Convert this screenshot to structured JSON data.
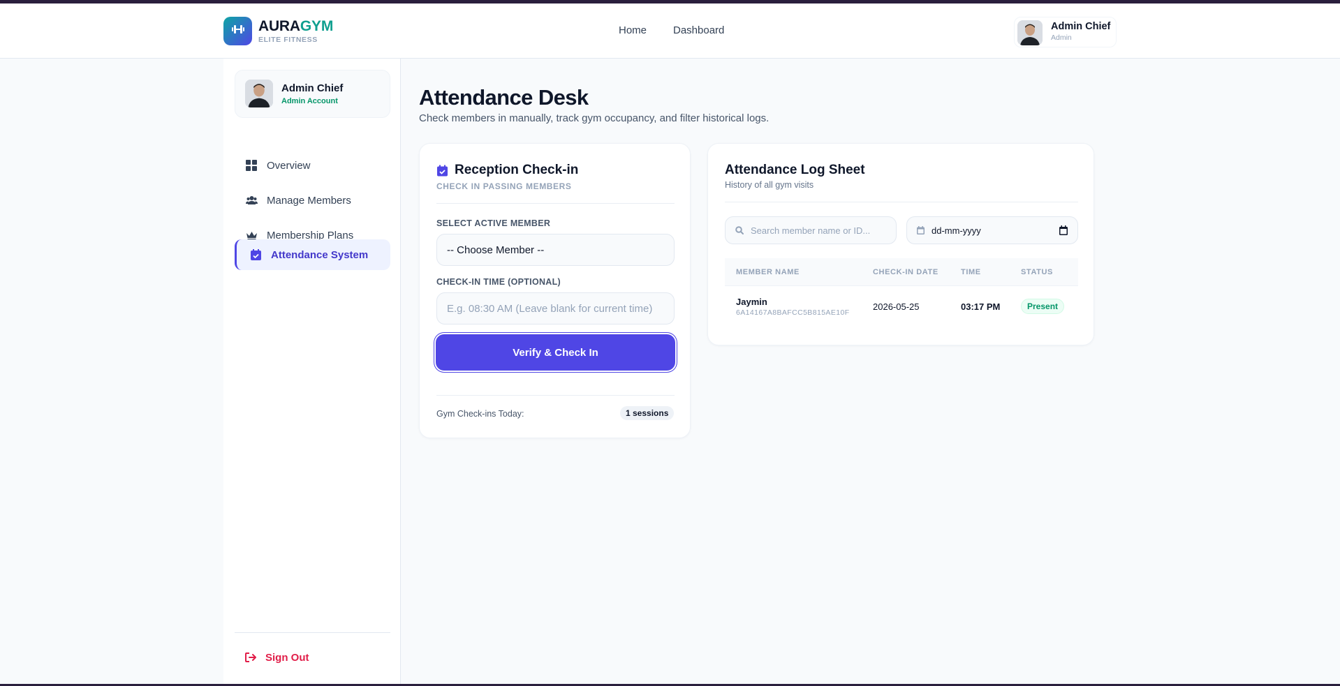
{
  "brand": {
    "name_part1": "AURA",
    "name_part2": "GYM",
    "subtitle": "ELITE FITNESS"
  },
  "nav": {
    "home": "Home",
    "dashboard": "Dashboard"
  },
  "user": {
    "name": "Admin Chief",
    "role": "Admin"
  },
  "sidebar": {
    "profile": {
      "name": "Admin Chief",
      "role": "Admin Account"
    },
    "items": [
      {
        "label": "Overview",
        "icon": "grid-icon"
      },
      {
        "label": "Manage Members",
        "icon": "users-icon"
      },
      {
        "label": "Membership Plans",
        "icon": "crown-icon"
      },
      {
        "label": "Attendance System",
        "icon": "calendar-check-icon",
        "active": true
      }
    ],
    "signout": "Sign Out"
  },
  "page": {
    "title": "Attendance Desk",
    "subtitle": "Check members in manually, track gym occupancy, and filter historical logs."
  },
  "checkin": {
    "title": "Reception Check-in",
    "subtitle": "CHECK IN PASSING MEMBERS",
    "member_label": "SELECT ACTIVE MEMBER",
    "member_value": "-- Choose Member --",
    "time_label": "CHECK-IN TIME (OPTIONAL)",
    "time_placeholder": "E.g. 08:30 AM (Leave blank for current time)",
    "button": "Verify & Check In",
    "stat_label": "Gym Check-ins Today:",
    "stat_value": "1 sessions"
  },
  "log": {
    "title": "Attendance Log Sheet",
    "subtitle": "History of all gym visits",
    "search_placeholder": "Search member name or ID...",
    "date_placeholder": "dd-mm-yyyy",
    "columns": [
      "MEMBER NAME",
      "CHECK-IN DATE",
      "TIME",
      "STATUS"
    ],
    "rows": [
      {
        "name": "Jaymin",
        "id": "6A14167A8BAFCC5B815AE10F",
        "date": "2026-05-25",
        "time": "03:17 PM",
        "status": "Present"
      }
    ]
  },
  "colors": {
    "accent": "#4f46e5",
    "brand_teal": "#0f9f8f",
    "success": "#059669",
    "danger": "#e11d48"
  }
}
